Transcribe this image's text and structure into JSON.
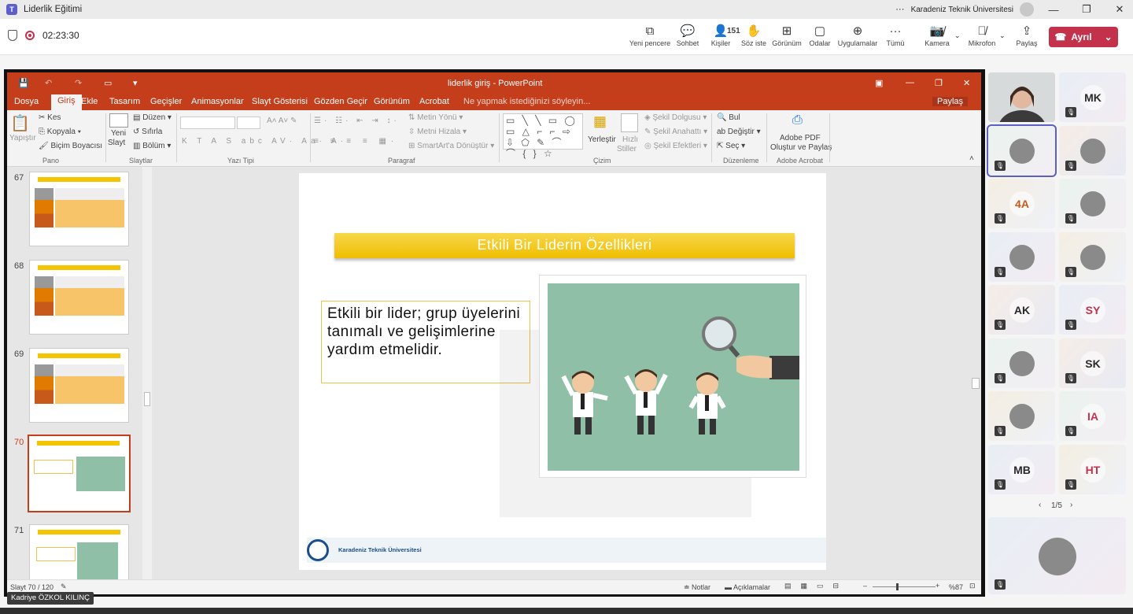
{
  "teams": {
    "window_title": "Liderlik Eğitimi",
    "org_name": "Karadeniz Teknik Üniversitesi",
    "more": "···",
    "timer": "02:23:30",
    "toolbar": [
      {
        "label": "Yeni pencere",
        "icon": "popout-icon",
        "glyph": "⧉"
      },
      {
        "label": "Sohbet",
        "icon": "chat-icon",
        "glyph": "💬"
      },
      {
        "label": "Kişiler",
        "icon": "people-icon",
        "glyph": "👤",
        "count": "151"
      },
      {
        "label": "Söz iste",
        "icon": "raise-hand-icon",
        "glyph": "✋"
      },
      {
        "label": "Görünüm",
        "icon": "view-icon",
        "glyph": "⊞"
      },
      {
        "label": "Odalar",
        "icon": "rooms-icon",
        "glyph": "▢"
      },
      {
        "label": "Uygulamalar",
        "icon": "apps-icon",
        "glyph": "⊕"
      },
      {
        "label": "Tümü",
        "icon": "more-icon",
        "glyph": "···"
      }
    ],
    "camera_label": "Kamera",
    "mic_label": "Mikrofon",
    "share_label": "Paylaş",
    "leave_label": "Ayrıl",
    "presenter_name": "Kadriye ÖZKOL KILINÇ",
    "gallery_page": "1/5",
    "participants": [
      {
        "initials": "",
        "type": "video"
      },
      {
        "initials": "MK",
        "type": "initials"
      },
      {
        "initials": "",
        "type": "person",
        "active": true
      },
      {
        "initials": "",
        "type": "person"
      },
      {
        "initials": "4A",
        "type": "initials",
        "color": "#c75a1a"
      },
      {
        "initials": "",
        "type": "person"
      },
      {
        "initials": "",
        "type": "person"
      },
      {
        "initials": "",
        "type": "person"
      },
      {
        "initials": "AK",
        "type": "initials"
      },
      {
        "initials": "SY",
        "type": "initials",
        "color": "#c4314b"
      },
      {
        "initials": "",
        "type": "person"
      },
      {
        "initials": "SK",
        "type": "initials"
      },
      {
        "initials": "",
        "type": "person"
      },
      {
        "initials": "IA",
        "type": "initials",
        "color": "#c4314b"
      },
      {
        "initials": "MB",
        "type": "initials"
      },
      {
        "initials": "HT",
        "type": "initials",
        "color": "#c4314b"
      }
    ]
  },
  "ppt": {
    "title": "liderlik giriş - PowerPoint",
    "share_label": "Paylaş",
    "tabs": [
      "Dosya",
      "Giriş",
      "Ekle",
      "Tasarım",
      "Geçişler",
      "Animasyonlar",
      "Slayt Gösterisi",
      "Gözden Geçir",
      "Görünüm",
      "Acrobat"
    ],
    "tell_me": "Ne yapmak istediğinizi söyleyin...",
    "ribbon": {
      "paste": "Yapıştır",
      "cut": "Kes",
      "copy": "Kopyala",
      "format_painter": "Biçim Boyacısı",
      "new_slide_1": "Yeni",
      "new_slide_2": "Slayt",
      "layout": "Düzen",
      "reset": "Sıfırla",
      "section": "Bölüm",
      "text_direction": "Metin Yönü",
      "align_text": "Metni Hizala",
      "smartart": "SmartArt'a Dönüştür",
      "arrange": "Yerleştir",
      "quick_styles_1": "Hızlı",
      "quick_styles_2": "Stiller",
      "shape_fill": "Şekil Dolgusu",
      "shape_outline": "Şekil Anahattı",
      "shape_effects": "Şekil Efektleri",
      "find": "Bul",
      "replace": "Değiştir",
      "select": "Seç",
      "acrobat_1": "Adobe PDF",
      "acrobat_2": "Oluştur ve Paylaş",
      "groups": [
        "Pano",
        "Slaytlar",
        "Yazı Tipi",
        "Paragraf",
        "Çizim",
        "Düzenleme",
        "Adobe Acrobat"
      ]
    },
    "thumbnails": [
      {
        "num": "67",
        "selected": false
      },
      {
        "num": "68",
        "selected": false
      },
      {
        "num": "69",
        "selected": false
      },
      {
        "num": "70",
        "selected": true
      },
      {
        "num": "71",
        "selected": false
      }
    ],
    "slide": {
      "title": "Etkili Bir Liderin Özellikleri",
      "body": "Etkili bir lider; grup üyelerini tanımalı ve gelişimlerine yardım etmelidir.",
      "footer": "Karadeniz Teknik Üniversitesi"
    },
    "status": {
      "slide_count": "Slayt 70 / 120",
      "notes": "Notlar",
      "comments": "Açıklamalar",
      "zoom": "%87"
    }
  }
}
